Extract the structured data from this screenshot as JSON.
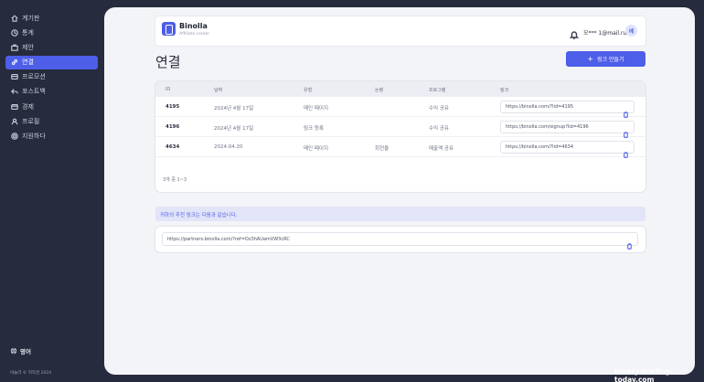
{
  "sidebar": {
    "items": [
      {
        "label": "계기판",
        "icon": "home-icon"
      },
      {
        "label": "통계",
        "icon": "clock-icon"
      },
      {
        "label": "제안",
        "icon": "briefcase-icon"
      },
      {
        "label": "연결",
        "icon": "link-icon",
        "active": true
      },
      {
        "label": "프로모션",
        "icon": "promo-icon"
      },
      {
        "label": "포스트백",
        "icon": "reply-icon"
      },
      {
        "label": "경제",
        "icon": "wallet-icon"
      },
      {
        "label": "프로필",
        "icon": "user-icon"
      },
      {
        "label": "지원하다",
        "icon": "support-icon"
      }
    ],
    "language": "영어",
    "copyright": "비놀라 © 저작권 2024"
  },
  "header": {
    "brand": "Binolla",
    "brand_sub": "Affiliate center",
    "user_email": "오*** 1@mail.ru",
    "avatar_initial": "에"
  },
  "main": {
    "title": "연결",
    "create_button": "링크 만들기",
    "table": {
      "columns": [
        "ID",
        "날짜",
        "유형",
        "논평",
        "프로그램",
        "링크"
      ],
      "rows": [
        {
          "id": "4195",
          "date": "2024년 4월 17일",
          "type": "메인 페이지",
          "comment": "",
          "program": "수익 공유",
          "link": "https://binolla.com/?lid=4195"
        },
        {
          "id": "4196",
          "date": "2024년 4월 17일",
          "type": "링크 등록",
          "comment": "",
          "program": "수익 공유",
          "link": "https://binolla.com/signup?lid=4196"
        },
        {
          "id": "4634",
          "date": "2024.04.20",
          "type": "메인 페이지",
          "comment": "회전율",
          "program": "매출액 공유",
          "link": "https://binolla.com/?lid=4634"
        }
      ],
      "pagination": "3개 중 1~3"
    },
    "referral_notice": "귀하의 추천 링크는 다음과 같습니다.",
    "referral_link": "https://partners.binolla.com/?ref=Oz3hAUamVW3cRC"
  },
  "watermark": "binary-trading-today.com",
  "colors": {
    "accent": "#4d5ee8",
    "sidebar_bg": "#262b3d",
    "panel_bg": "#f3f4f7"
  }
}
